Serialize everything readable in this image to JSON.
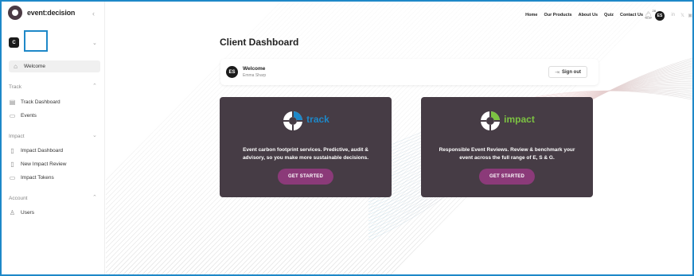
{
  "brand": {
    "name": "event:decision"
  },
  "org": {
    "initial": "C"
  },
  "sidebar": {
    "welcome": "Welcome",
    "sections": [
      {
        "label": "Track",
        "items": [
          "Track Dashboard",
          "Events"
        ]
      },
      {
        "label": "Impact",
        "items": [
          "Impact Dashboard",
          "New Impact Review",
          "Impact Tokens"
        ]
      },
      {
        "label": "Account",
        "items": [
          "Users"
        ]
      }
    ]
  },
  "topnav": {
    "links": [
      "Home",
      "Our Products",
      "About Us",
      "Quiz",
      "Contact Us"
    ],
    "notification_count": "28",
    "user_initials": "ES",
    "social": [
      "in",
      "𝕏",
      "▣"
    ]
  },
  "page": {
    "title": "Client Dashboard"
  },
  "welcome_card": {
    "avatar": "ES",
    "title": "Welcome",
    "user_name": "Emma Sharp",
    "signout_label": "Sign out"
  },
  "products": [
    {
      "name": "track",
      "name_color": "#1e88c8",
      "description_line1": "Event carbon footprint services. Predictive, audit &",
      "description_line2": "advisory, so you make more sustainable decisions.",
      "button": "GET STARTED"
    },
    {
      "name": "impact",
      "name_color": "#7cc242",
      "description_line1": "Responsible Event Reviews. Review & benchmark your",
      "description_line2": "event across the full range of E, S & G.",
      "button": "GET STARTED"
    }
  ],
  "colors": {
    "card_bg": "#463c45",
    "button_bg": "#8b3a79",
    "accent_blue": "#1e88c8"
  }
}
